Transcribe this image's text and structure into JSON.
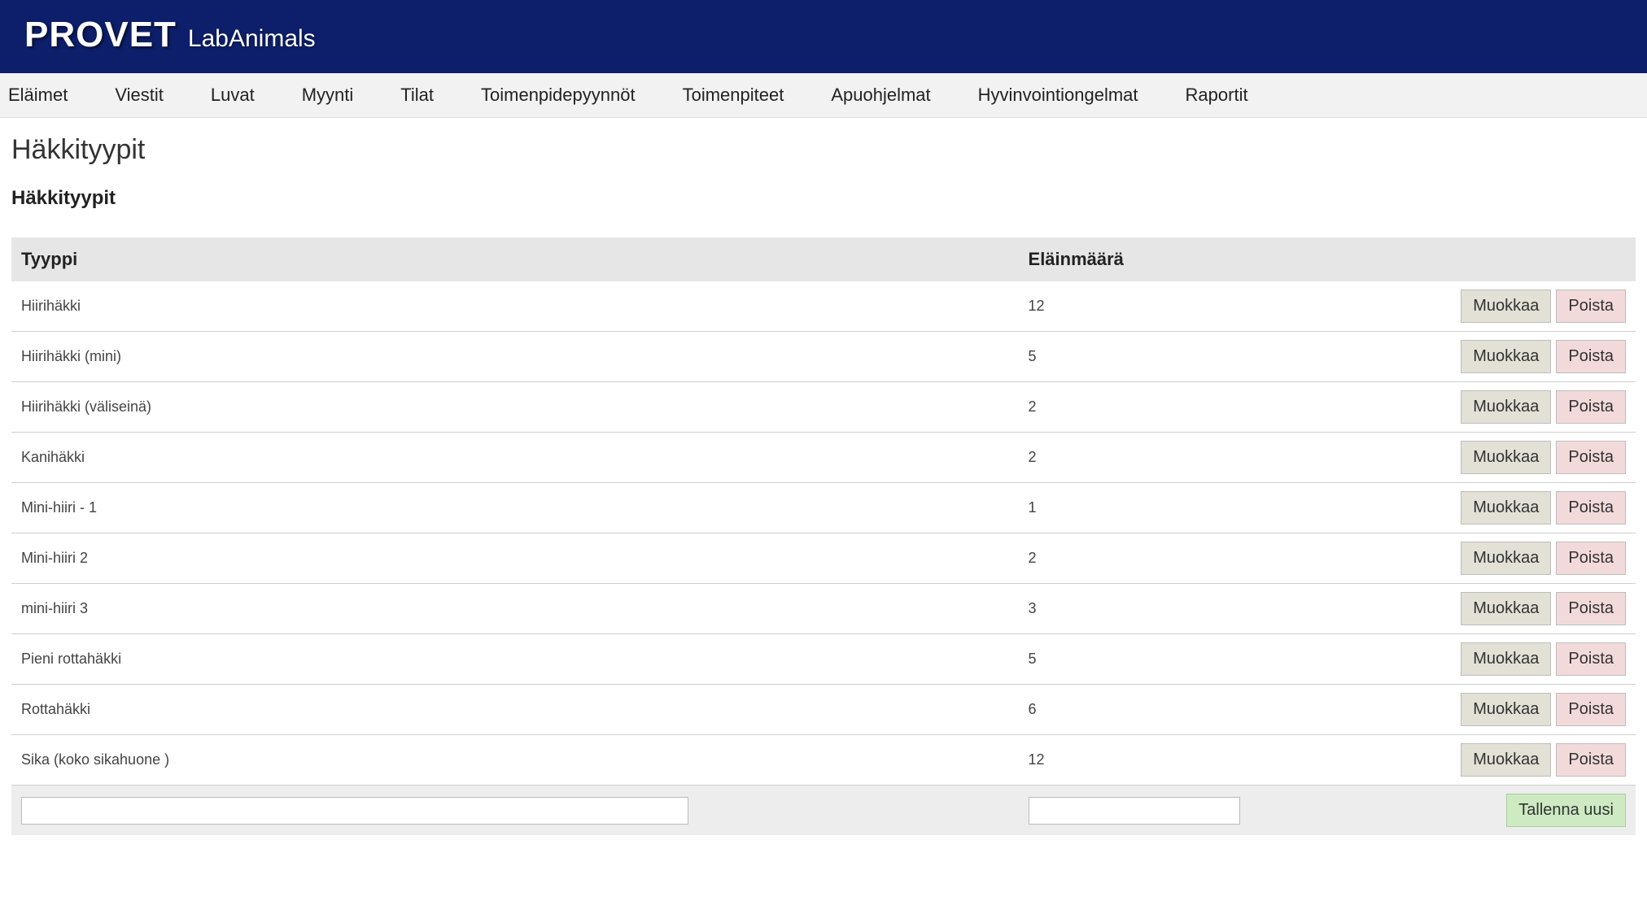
{
  "header": {
    "brand": "PROVET",
    "sub": "LabAnimals"
  },
  "nav": {
    "items": [
      "Eläimet",
      "Viestit",
      "Luvat",
      "Myynti",
      "Tilat",
      "Toimenpidepyynnöt",
      "Toimenpiteet",
      "Apuohjelmat",
      "Hyvinvointiongelmat",
      "Raportit"
    ]
  },
  "page": {
    "title": "Häkkityypit",
    "section_title": "Häkkityypit"
  },
  "table": {
    "headers": {
      "type": "Tyyppi",
      "count": "Eläinmäärä"
    },
    "row_actions": {
      "edit": "Muokkaa",
      "delete": "Poista"
    },
    "rows": [
      {
        "type": "Hiirihäkki",
        "count": "12"
      },
      {
        "type": "Hiirihäkki (mini)",
        "count": "5"
      },
      {
        "type": "Hiirihäkki (väliseinä)",
        "count": "2"
      },
      {
        "type": "Kanihäkki",
        "count": "2"
      },
      {
        "type": "Mini-hiiri - 1",
        "count": "1"
      },
      {
        "type": "Mini-hiiri 2",
        "count": "2"
      },
      {
        "type": "mini-hiiri 3",
        "count": "3"
      },
      {
        "type": "Pieni rottahäkki",
        "count": "5"
      },
      {
        "type": "Rottahäkki",
        "count": "6"
      },
      {
        "type": "Sika (koko sikahuone )",
        "count": "12"
      }
    ],
    "footer": {
      "type_input_value": "",
      "count_input_value": "",
      "save_label": "Tallenna uusi"
    }
  }
}
